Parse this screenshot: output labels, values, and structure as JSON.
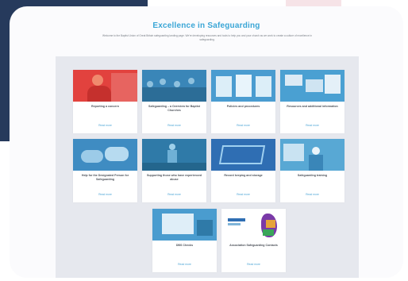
{
  "page": {
    "heading": "Excellence in Safeguarding",
    "intro": "Welcome to the Baptist Union of Great Britain safeguarding landing page. We're developing resources and tools to help you and your church as we work to create a culture of excellence in safeguarding."
  },
  "read_more_label": "Read more",
  "tiles": [
    {
      "title": "Reporting a concern",
      "icon": "person-photo",
      "color": "#e2423e"
    },
    {
      "title": "Safeguarding – a Overview for Baptist Churches",
      "icon": "crowd-photo",
      "color": "#3a86b8"
    },
    {
      "title": "Policies and procedures",
      "icon": "documents-photo",
      "color": "#4a9cd0"
    },
    {
      "title": "Resources and additional information",
      "icon": "leaflets-photo",
      "color": "#4aa0d2"
    },
    {
      "title": "Help for the Designated Person for Safeguarding",
      "icon": "hands-photo",
      "color": "#3f8cc2"
    },
    {
      "title": "Supporting those who have experienced abuse",
      "icon": "figure-photo",
      "color": "#2f7aa8"
    },
    {
      "title": "Record keeping and storage",
      "icon": "screen-photo",
      "color": "#2f6eb3"
    },
    {
      "title": "Safeguarding training",
      "icon": "training-photo",
      "color": "#58a8d4"
    },
    {
      "title": "DBS Checks",
      "icon": "computer-photo",
      "color": "#4a9ccf"
    },
    {
      "title": "Association Safeguarding Contacts",
      "icon": "map-photo",
      "color": "#ffffff"
    }
  ]
}
